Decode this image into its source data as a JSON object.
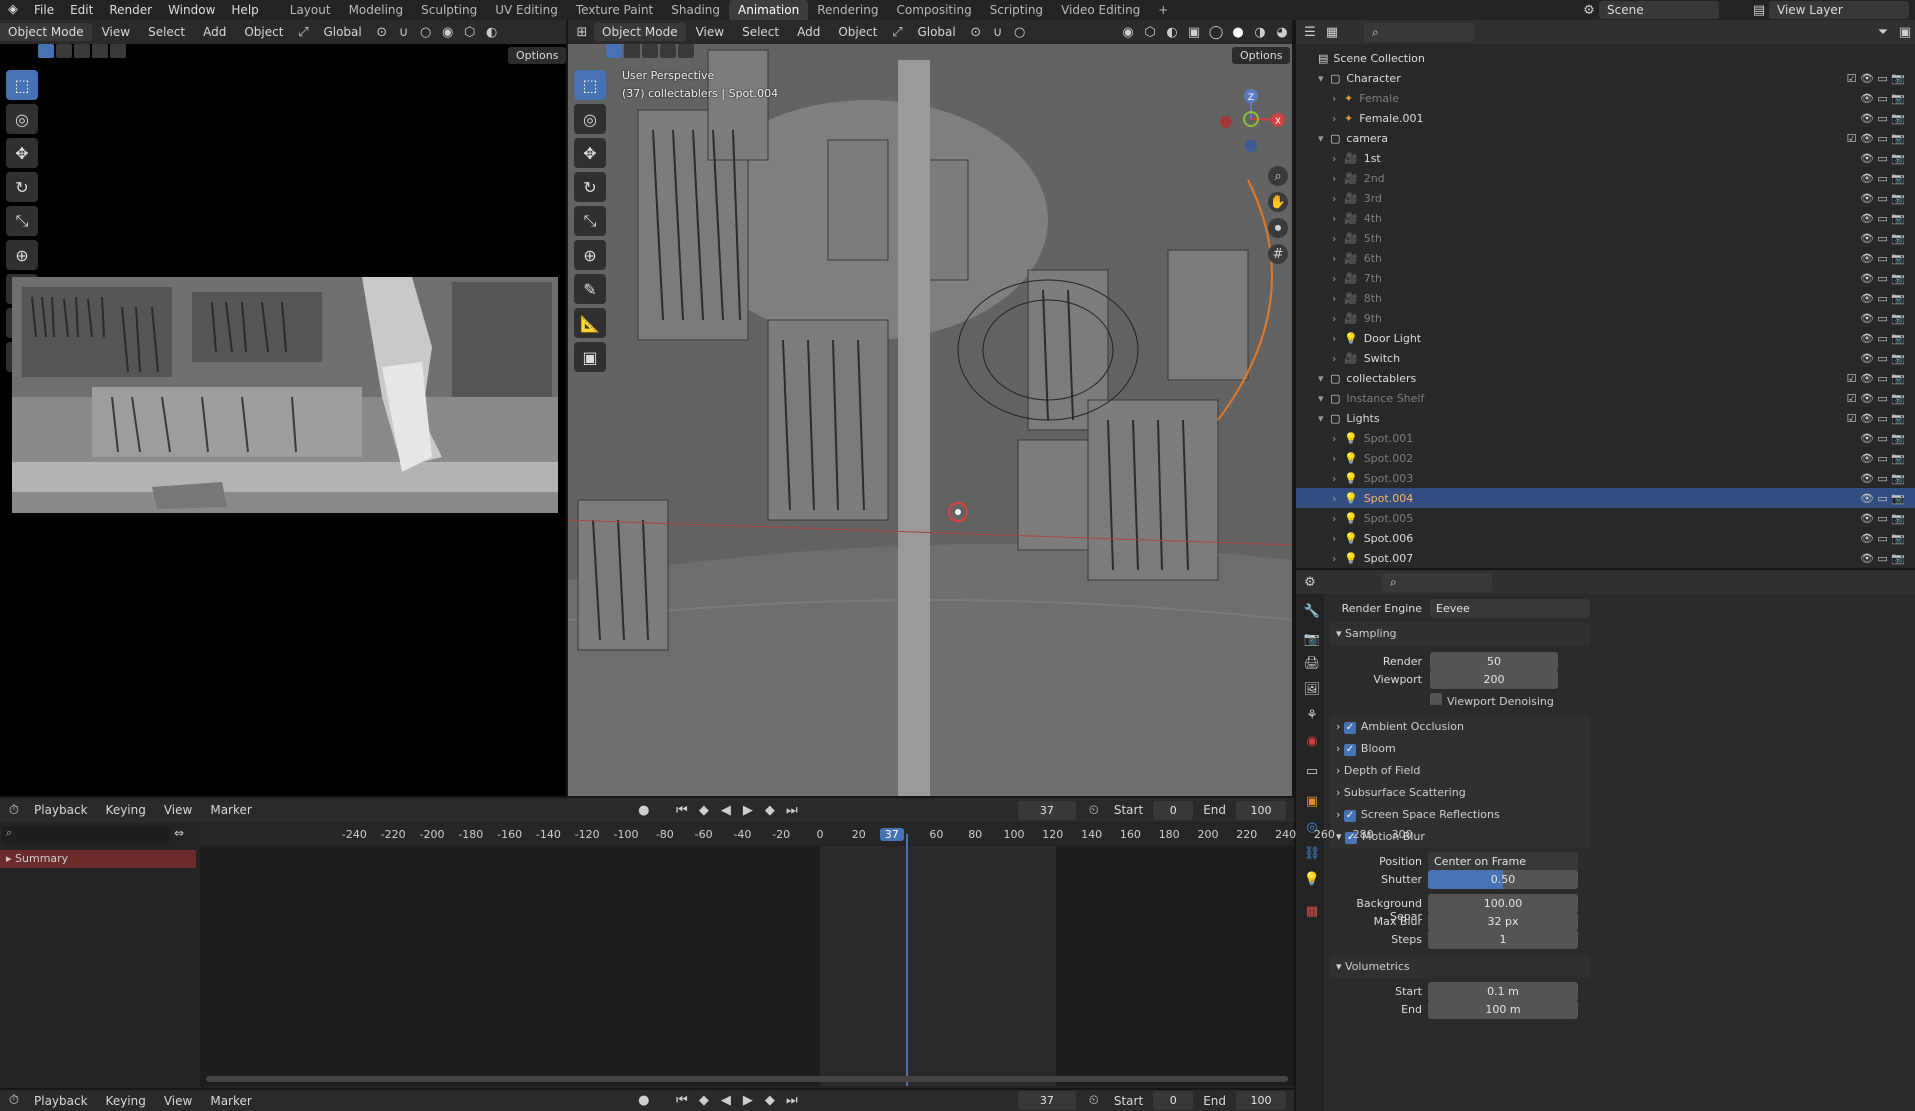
{
  "menu": {
    "file": "File",
    "edit": "Edit",
    "render": "Render",
    "window": "Window",
    "help": "Help"
  },
  "workspaces": [
    "Layout",
    "Modeling",
    "Sculpting",
    "UV Editing",
    "Texture Paint",
    "Shading",
    "Animation",
    "Rendering",
    "Compositing",
    "Scripting",
    "Video Editing"
  ],
  "scene": "Scene",
  "view_layer": "View Layer",
  "left_view": {
    "mode": "Object Mode",
    "view": "View",
    "select": "Select",
    "add": "Add",
    "object": "Object",
    "orientation": "Global",
    "options": "Options"
  },
  "main_view": {
    "mode": "Object Mode",
    "view": "View",
    "select": "Select",
    "add": "Add",
    "object": "Object",
    "orientation": "Global",
    "options": "Options",
    "overlay_title": "User Perspective",
    "overlay_sub": "(37) collectablers | Spot.004"
  },
  "outliner": {
    "root": "Scene Collection",
    "rows": [
      {
        "label": "Character",
        "indent": 1,
        "icon": "collection-icon",
        "dim": false,
        "sel": false
      },
      {
        "label": "Female",
        "indent": 2,
        "icon": "armature-icon",
        "dim": true,
        "sel": false
      },
      {
        "label": "Female.001",
        "indent": 2,
        "icon": "armature-icon",
        "dim": false,
        "sel": false
      },
      {
        "label": "camera",
        "indent": 1,
        "icon": "collection-icon",
        "dim": false,
        "sel": false
      },
      {
        "label": "1st",
        "indent": 2,
        "icon": "camera-icon",
        "dim": false,
        "sel": false
      },
      {
        "label": "2nd",
        "indent": 2,
        "icon": "camera-icon",
        "dim": true,
        "sel": false
      },
      {
        "label": "3rd",
        "indent": 2,
        "icon": "camera-icon",
        "dim": true,
        "sel": false
      },
      {
        "label": "4th",
        "indent": 2,
        "icon": "camera-icon",
        "dim": true,
        "sel": false
      },
      {
        "label": "5th",
        "indent": 2,
        "icon": "camera-icon",
        "dim": true,
        "sel": false
      },
      {
        "label": "6th",
        "indent": 2,
        "icon": "camera-icon",
        "dim": true,
        "sel": false
      },
      {
        "label": "7th",
        "indent": 2,
        "icon": "camera-icon",
        "dim": true,
        "sel": false
      },
      {
        "label": "8th",
        "indent": 2,
        "icon": "camera-icon",
        "dim": true,
        "sel": false
      },
      {
        "label": "9th",
        "indent": 2,
        "icon": "camera-icon",
        "dim": true,
        "sel": false
      },
      {
        "label": "Door Light",
        "indent": 2,
        "icon": "light-icon",
        "dim": false,
        "sel": false
      },
      {
        "label": "Switch",
        "indent": 2,
        "icon": "camera-icon",
        "dim": false,
        "sel": false
      },
      {
        "label": "collectablers",
        "indent": 1,
        "icon": "collection-icon",
        "dim": false,
        "sel": false
      },
      {
        "label": "Instance Shelf",
        "indent": 1,
        "icon": "collection-icon",
        "dim": true,
        "sel": false
      },
      {
        "label": "Lights",
        "indent": 1,
        "icon": "collection-icon",
        "dim": false,
        "sel": false
      },
      {
        "label": "Spot.001",
        "indent": 2,
        "icon": "light-icon",
        "dim": true,
        "sel": false
      },
      {
        "label": "Spot.002",
        "indent": 2,
        "icon": "light-icon",
        "dim": true,
        "sel": false
      },
      {
        "label": "Spot.003",
        "indent": 2,
        "icon": "light-icon",
        "dim": true,
        "sel": false
      },
      {
        "label": "Spot.004",
        "indent": 2,
        "icon": "light-icon",
        "dim": false,
        "sel": true
      },
      {
        "label": "Spot.005",
        "indent": 2,
        "icon": "light-icon",
        "dim": true,
        "sel": false
      },
      {
        "label": "Spot.006",
        "indent": 2,
        "icon": "light-icon",
        "dim": false,
        "sel": false
      },
      {
        "label": "Spot.007",
        "indent": 2,
        "icon": "light-icon",
        "dim": false,
        "sel": false
      }
    ]
  },
  "properties": {
    "render_engine_label": "Render Engine",
    "render_engine": "Eevee",
    "sampling": "Sampling",
    "render_label": "Render",
    "render_val": "50",
    "viewport_label": "Viewport",
    "viewport_val": "200",
    "denoise": "Viewport Denoising",
    "ao": "Ambient Occlusion",
    "bloom": "Bloom",
    "dof": "Depth of Field",
    "sss": "Subsurface Scattering",
    "ssr": "Screen Space Reflections",
    "motion_blur": "Motion Blur",
    "position_label": "Position",
    "position_val": "Center on Frame",
    "shutter_label": "Shutter",
    "shutter_val": "0.50",
    "shutter_fraction": 0.5,
    "bg_sep_label": "Background Separ",
    "bg_sep_val": "100.00",
    "max_blur_label": "Max Blur",
    "max_blur_val": "32 px",
    "steps_label": "Steps",
    "steps_val": "1",
    "volumetrics": "Volumetrics",
    "vol_start_label": "Start",
    "vol_start_val": "0.1 m",
    "vol_end_label": "End",
    "vol_end_val": "100 m"
  },
  "timeline": {
    "playback": "Playback",
    "keying": "Keying",
    "view": "View",
    "marker": "Marker",
    "frame": "37",
    "start_label": "Start",
    "start_val": "0",
    "end_label": "End",
    "end_val": "100",
    "summary": "Summary",
    "ticks": [
      "-240",
      "-220",
      "-200",
      "-180",
      "-160",
      "-140",
      "-120",
      "-100",
      "-80",
      "-60",
      "-40",
      "-20",
      "0",
      "20",
      "37",
      "60",
      "80",
      "100",
      "120",
      "140",
      "160",
      "180",
      "200",
      "220",
      "240",
      "260",
      "280",
      "300"
    ]
  },
  "colors": {
    "accent": "#4772b3",
    "selected_row": "#334d80",
    "selected_text": "#ffb75e",
    "playhead": "#4772b3",
    "summary_bg": "#6b2b2b"
  }
}
